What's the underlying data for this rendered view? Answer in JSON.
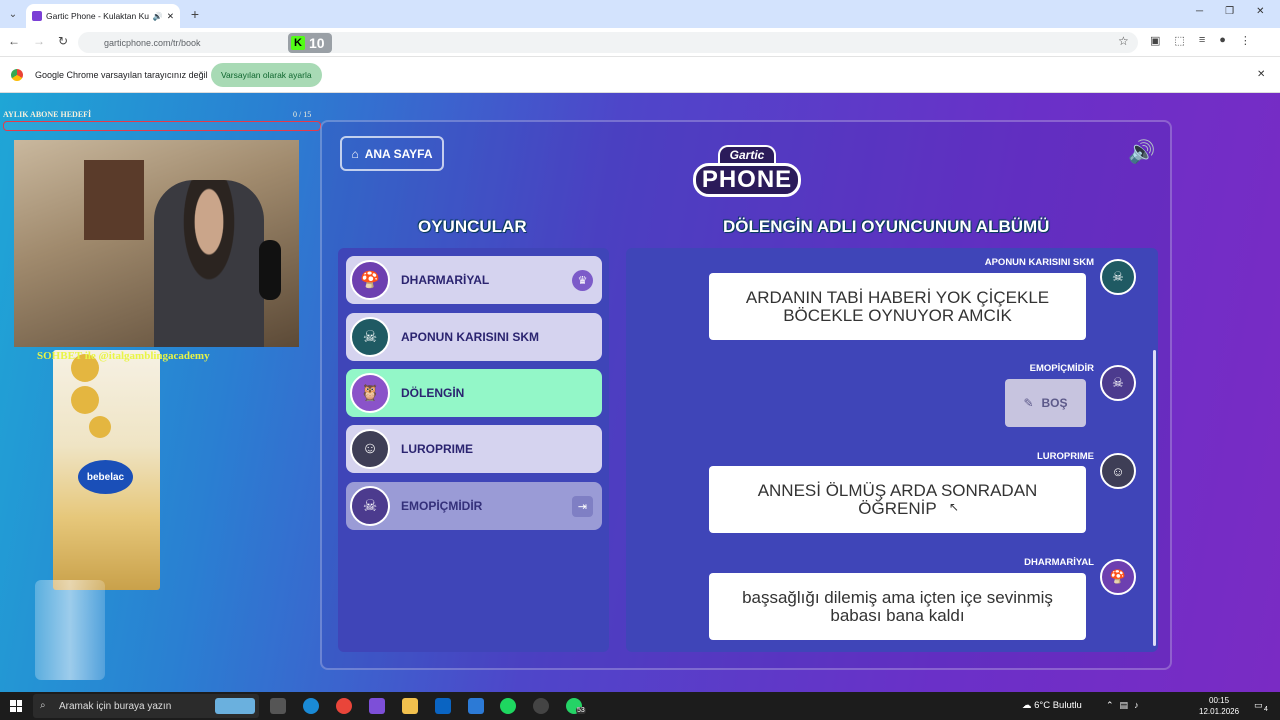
{
  "browser": {
    "tab_title": "Gartic Phone - Kulaktan Kul",
    "url": "garticphone.com/tr/book",
    "kick_count": "10",
    "infobar_text": "Google Chrome varsayılan tarayıcınız değil",
    "infobar_button": "Varsayılan olarak ayarla"
  },
  "stream": {
    "goal_label": "AYLIK ABONE HEDEFİ",
    "goal_count": "0 / 15",
    "goal_progress": 0,
    "overlay_text": "SOHBET ile @italgamblingacademy"
  },
  "game": {
    "home_button": "ANA SAYFA",
    "logo_top": "Gartic",
    "logo_main": "PHONE",
    "players_heading": "OYUNCULAR",
    "album_heading": "DÖLENGİN ADLI OYUNCUNUN ALBÜMÜ",
    "players": [
      {
        "name": "DHARMARİYAL",
        "icon": "crown-icon"
      },
      {
        "name": "APONUN KARISINI SKM",
        "icon": ""
      },
      {
        "name": "DÖLENGİN",
        "icon": ""
      },
      {
        "name": "LUROPRIME",
        "icon": ""
      },
      {
        "name": "EMOPİÇMİDİR",
        "icon": "exit-icon"
      }
    ],
    "album": [
      {
        "author": "APONUN KARISINI SKM",
        "text": "ARDANIN TABİ HABERİ YOK ÇİÇEKLE BÖCEKLE OYNUYOR AMCIK"
      },
      {
        "author": "EMOPİÇMİDİR",
        "text": "BOŞ",
        "type": "empty-drawing"
      },
      {
        "author": "LUROPRIME",
        "text": "ANNESİ ÖLMÜŞ ARDA SONRADAN ÖĞRENİP"
      },
      {
        "author": "DHARMARİYAL",
        "text": "başsağlığı dilemiş ama içten içe sevinmiş babası bana kaldı"
      }
    ]
  },
  "taskbar": {
    "search_placeholder": "Aramak için buraya yazın",
    "weather": "6°C  Bulutlu",
    "time": "00:15",
    "date": "12.01.2026",
    "whatsapp_badge": "53",
    "notif_count": "4"
  },
  "colors": {
    "accent_active": "#93f7c8",
    "player_bg": "#d5d3ef",
    "list_bg": "#3f45b8"
  }
}
